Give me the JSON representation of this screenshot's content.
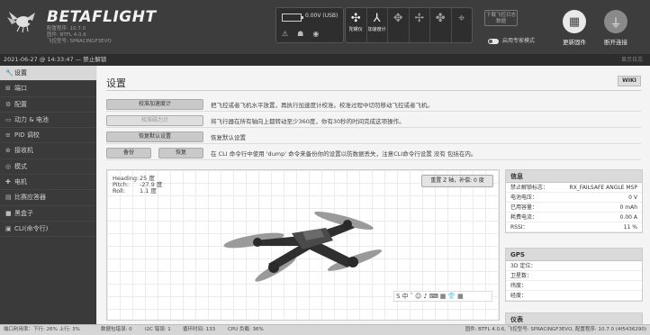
{
  "header": {
    "brand": "BETAFLIGHT",
    "sub_lines": [
      "配置程序: 10.7.0",
      "固件: BTFL 4.0.6",
      "飞控型号: SPRACINGF3EVO"
    ],
    "battery_text": "0.00V (USB)",
    "sensors": [
      {
        "glyph": "✣",
        "label": "陀螺仪",
        "on": true
      },
      {
        "glyph": "⅄",
        "label": "加速度计",
        "on": true
      },
      {
        "glyph": "✥",
        "label": "",
        "on": false
      },
      {
        "glyph": "✢",
        "label": "",
        "on": false
      },
      {
        "glyph": "✤",
        "label": "",
        "on": false
      },
      {
        "glyph": "⌖",
        "label": "",
        "on": false
      }
    ],
    "dump_button": "下载飞控日志数据",
    "expert_mode": "启用专家模式",
    "update_firmware": "更新固件",
    "disconnect": "断开连接"
  },
  "logbar": {
    "message": "2021-06-27 @ 14:33:47 — 禁止解锁",
    "show_log": "显示日志"
  },
  "sidebar": {
    "items": [
      {
        "label": "设置",
        "icon": "wrench-icon",
        "glyph": "🔧"
      },
      {
        "label": "端口",
        "icon": "port-icon",
        "glyph": "⊞"
      },
      {
        "label": "配置",
        "icon": "gear-icon",
        "glyph": "⚙"
      },
      {
        "label": "动力 & 电池",
        "icon": "battery-icon",
        "glyph": "▭"
      },
      {
        "label": "PID 调校",
        "icon": "tune-icon",
        "glyph": "≡"
      },
      {
        "label": "接收机",
        "icon": "receiver-icon",
        "glyph": "⊛"
      },
      {
        "label": "模式",
        "icon": "modes-icon",
        "glyph": "◎"
      },
      {
        "label": "电机",
        "icon": "motor-icon",
        "glyph": "✚"
      },
      {
        "label": "比赛应答器",
        "icon": "transponder-icon",
        "glyph": "▤"
      },
      {
        "label": "黑盒子",
        "icon": "blackbox-icon",
        "glyph": "■"
      },
      {
        "label": "CLI(命令行)",
        "icon": "cli-icon",
        "glyph": "▣"
      }
    ]
  },
  "main": {
    "title": "设置",
    "wiki": "WIKI",
    "rows": [
      {
        "button": "校准加速度计",
        "desc": "把飞控或者飞机水平放置，再执行加速度计校准。校准过程中切勿移动飞控或者飞机。",
        "disabled": false
      },
      {
        "button": "校准磁力计",
        "desc": "将飞行器在所有轴向上都转动至少360度，你有30秒的时间完成这项操作。",
        "disabled": true
      },
      {
        "button": "恢复默认设置",
        "desc": "恢复默认设置",
        "disabled": false
      },
      {
        "button": "备份",
        "button2": "恢复",
        "desc": "在 CLI 命令行中使用 'dump' 命令来备份你的设置以防数据丢失，注意CLI命令行设置 没有 包括在内。",
        "disabled": false
      }
    ],
    "attitude": [
      {
        "label": "Heading:",
        "value": "25 度"
      },
      {
        "label": "Pitch:",
        "value": "-27.9 度"
      },
      {
        "label": "Roll:",
        "value": "1.1 度"
      }
    ],
    "reset_z": "重置 Z 轴，补偿: 0 度",
    "ime_bar": "S中ˇ☺♪⌨▦👕▦"
  },
  "info": {
    "title": "信息",
    "rows": [
      {
        "label": "禁止解锁标志：",
        "value": "RX_FAILSAFE ANGLE MSP"
      },
      {
        "label": "电池电压：",
        "value": "0 V"
      },
      {
        "label": "已用容量：",
        "value": "0 mAh"
      },
      {
        "label": "耗费电流：",
        "value": "0.00 A"
      },
      {
        "label": "RSSI：",
        "value": "11 %"
      }
    ]
  },
  "gps": {
    "title": "GPS",
    "rows": [
      {
        "label": "3D 定位：",
        "value": ""
      },
      {
        "label": "卫星数：",
        "value": ""
      },
      {
        "label": "纬度：",
        "value": ""
      },
      {
        "label": "经度：",
        "value": ""
      }
    ]
  },
  "instruments": {
    "title": "仪表"
  },
  "footer": {
    "port_util": "端口利用率：下行: 26% 上行: 3%",
    "packet_error": "数据包错误: 0",
    "i2c_error": "I2C 错误: 1",
    "cycle_time": "循环时间: 133",
    "cpu_load": "CPU 负载: 36%",
    "firmware": "固件: BTFL 4.0.6, 飞控型号: SPRACINGF3EVO, 配置程序: 10.7.0 (4f5436290)"
  }
}
